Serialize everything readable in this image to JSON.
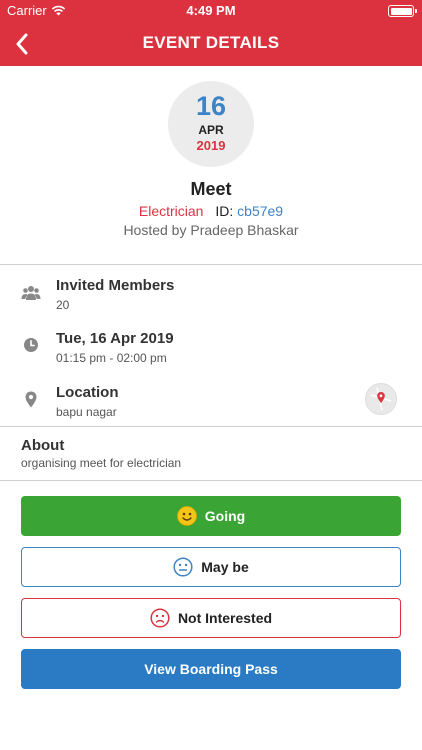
{
  "status_bar": {
    "carrier": "Carrier",
    "time": "4:49 PM"
  },
  "nav": {
    "title": "EVENT DETAILS",
    "back_icon": "chevron-left-icon"
  },
  "date": {
    "day": "16",
    "month": "APR",
    "year": "2019"
  },
  "event": {
    "title": "Meet",
    "category": "Electrician",
    "id_label": "ID:",
    "id_value": "cb57e9",
    "hosted_by": "Hosted by Pradeep Bhaskar"
  },
  "details": {
    "members": {
      "title": "Invited Members",
      "value": "20",
      "icon": "group-icon"
    },
    "datetime": {
      "title": "Tue, 16 Apr 2019",
      "value": "01:15 pm - 02:00 pm",
      "icon": "clock-icon"
    },
    "location": {
      "title": "Location",
      "value": "bapu nagar",
      "icon": "pin-icon"
    }
  },
  "about": {
    "title": "About",
    "text": "organising meet for electrician"
  },
  "buttons": {
    "going": "Going",
    "maybe": "May be",
    "not_interested": "Not Interested",
    "boarding_pass": "View Boarding Pass"
  },
  "colors": {
    "brand_red": "#dc3240",
    "accent_blue": "#3d84c6",
    "going_green": "#3aa534",
    "pass_blue": "#2a7bc4"
  }
}
